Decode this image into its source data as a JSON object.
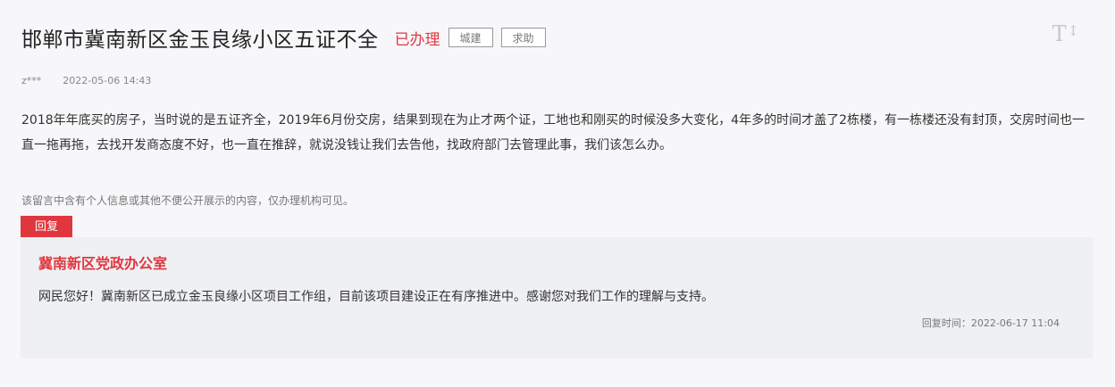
{
  "header": {
    "title": "邯郸市冀南新区金玉良缘小区五证不全",
    "status": "已办理",
    "tags": [
      "城建",
      "求助"
    ]
  },
  "font_toggle": {
    "label": "T",
    "arrows": "↕",
    "icon": "font-size-icon"
  },
  "meta": {
    "author": "z***",
    "date": "2022-05-06 14:43"
  },
  "content": "2018年年底买的房子，当时说的是五证齐全，2019年6月份交房，结果到现在为止才两个证，工地也和刚买的时候没多大变化，4年多的时间才盖了2栋楼，有一栋楼还没有封顶，交房时间也一直一拖再拖，去找开发商态度不好，也一直在推辞，就说没钱让我们去告他，找政府部门去管理此事，我们该怎么办。",
  "notice": "该留言中含有个人信息或其他不便公开展示的内容，仅办理机构可见。",
  "reply": {
    "tab_label": "回复",
    "org": "冀南新区党政办公室",
    "text": "网民您好！冀南新区已成立金玉良缘小区项目工作组，目前该项目建设正在有序推进中。感谢您对我们工作的理解与支持。",
    "time": "回复时间：2022-06-17 11:04"
  },
  "colors": {
    "accent": "#e0373f",
    "background": "#f7f6f9",
    "reply_background": "#eff0f4"
  }
}
